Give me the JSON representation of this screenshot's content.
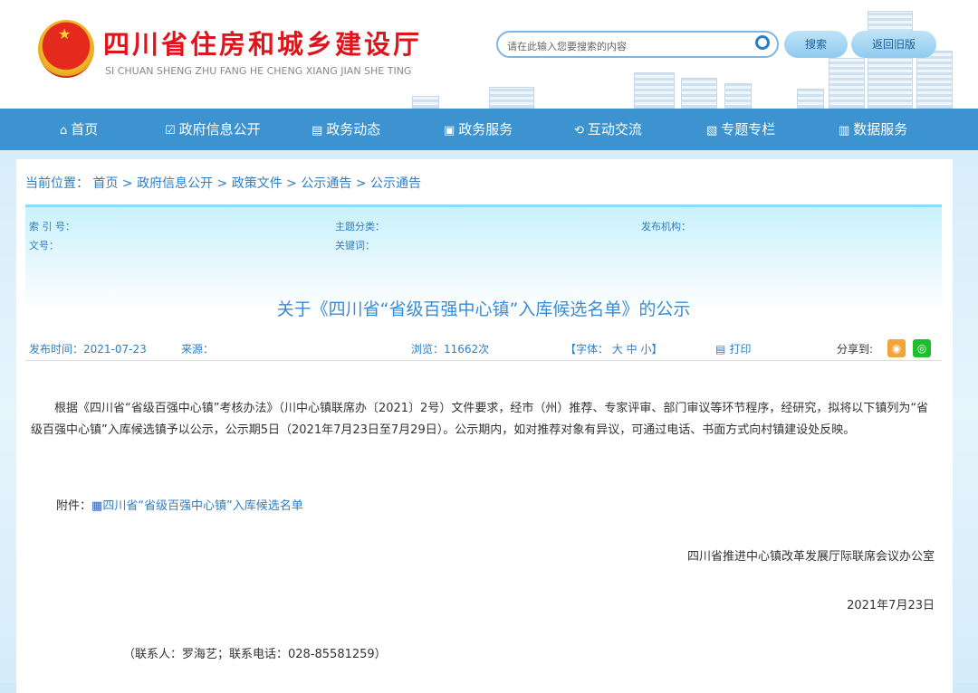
{
  "header": {
    "logo_cn": "四川省住房和城乡建设厅",
    "logo_en": "SI CHUAN SHENG ZHU FANG HE CHENG XIANG JIAN SHE TING",
    "search_placeholder": "请在此输入您要搜索的内容",
    "search_button": "搜索",
    "old_version_button": "返回旧版"
  },
  "nav": [
    {
      "label": "首页",
      "icon": "home-icon",
      "glyph": "⌂"
    },
    {
      "label": "政府信息公开",
      "icon": "edit-icon",
      "glyph": "☑"
    },
    {
      "label": "政务动态",
      "icon": "news-icon",
      "glyph": "▤"
    },
    {
      "label": "政务服务",
      "icon": "monitor-icon",
      "glyph": "▣"
    },
    {
      "label": "互动交流",
      "icon": "exchange-icon",
      "glyph": "⟲"
    },
    {
      "label": "专题专栏",
      "icon": "image-icon",
      "glyph": "▧"
    },
    {
      "label": "数据服务",
      "icon": "data-icon",
      "glyph": "▥"
    }
  ],
  "breadcrumb": {
    "label": "当前位置：",
    "items": [
      "首页",
      "政府信息公开",
      "政策文件",
      "公示通告",
      "公示通告"
    ]
  },
  "meta": {
    "index_no": "索 引 号：",
    "topic": "主题分类：",
    "publisher": "发布机构：",
    "doc_no": "文号：",
    "keywords": "关键词："
  },
  "article": {
    "title": "关于《四川省“省级百强中心镇”入库候选名单》的公示",
    "publish_time": "发布时间：2021-07-23",
    "source": "来源：",
    "views": "浏览：11662次",
    "font_size": "【字体： 大 中 小】",
    "print": "打印",
    "share": "分享到:",
    "paragraph": "根据《四川省“省级百强中心镇”考核办法》（川中心镇联席办〔2021〕2号）文件要求，经市（州）推荐、专家评审、部门审议等环节程序，经研究，拟将以下镇列为“省级百强中心镇”入库候选镇予以公示，公示期5日（2021年7月23日至7月29日）。公示期内，如对推荐对象有异议，可通过电话、书面方式向村镇建设处反映。",
    "attachment_label": "附件：",
    "attachment_link": "四川省“省级百强中心镇”入库候选名单",
    "signature": "四川省推进中心镇改革发展厅际联席会议办公室",
    "date": "2021年7月23日",
    "contact": "（联系人：罗海艺；联系电话：028-85581259）"
  }
}
